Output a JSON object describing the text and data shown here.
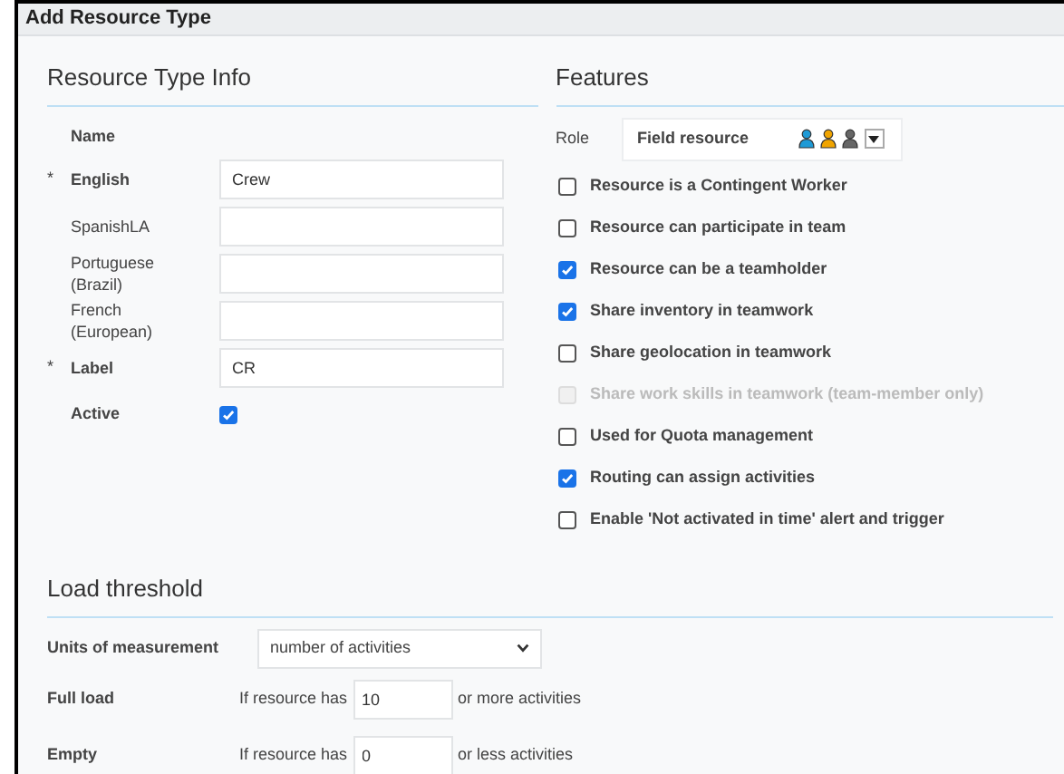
{
  "window": {
    "title": "Add Resource Type"
  },
  "resource_type_info": {
    "heading": "Resource Type Info",
    "name_label": "Name",
    "fields": [
      {
        "label": "English",
        "required_mark": "*",
        "value": "Crew"
      },
      {
        "label": "SpanishLA"
      },
      {
        "label": "Portuguese (Brazil)"
      },
      {
        "label": "French (European)"
      },
      {
        "label": "Label",
        "required_mark": "*",
        "value": "CR"
      }
    ],
    "active": {
      "label": "Active",
      "checked": true
    }
  },
  "features": {
    "heading": "Features",
    "role": {
      "label": "Role",
      "value": "Field resource"
    },
    "options": [
      {
        "label": "Resource is a Contingent Worker",
        "checked": false,
        "disabled": false
      },
      {
        "label": "Resource can participate in team",
        "checked": false,
        "disabled": false
      },
      {
        "label": "Resource can be a teamholder",
        "checked": true,
        "disabled": false
      },
      {
        "label": "Share inventory in teamwork",
        "checked": true,
        "disabled": false
      },
      {
        "label": "Share geolocation in teamwork",
        "checked": false,
        "disabled": false
      },
      {
        "label": "Share work skills in teamwork (team-member only)",
        "checked": false,
        "disabled": true
      },
      {
        "label": "Used for Quota management",
        "checked": false,
        "disabled": false
      },
      {
        "label": "Routing can assign activities",
        "checked": true,
        "disabled": false
      },
      {
        "label": "Enable 'Not activated in time' alert and trigger",
        "checked": false,
        "disabled": false
      }
    ]
  },
  "load_threshold": {
    "heading": "Load threshold",
    "units": {
      "label": "Units of measurement",
      "value": "number of activities"
    },
    "rows": [
      {
        "label": "Full load",
        "prefix": "If resource has",
        "value": "10",
        "suffix": "or more activities"
      },
      {
        "label": "Empty",
        "prefix": "If resource has",
        "value": "0",
        "suffix": "or less activities"
      }
    ]
  }
}
